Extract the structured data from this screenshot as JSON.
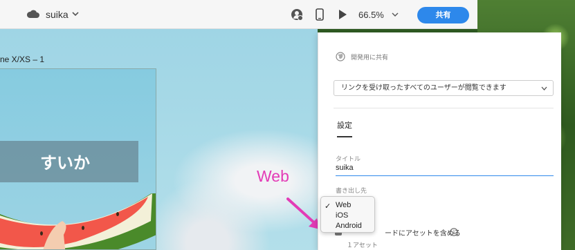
{
  "titlebar": {
    "doc_title": "suika",
    "icons": [
      "cloud-icon",
      "chevron-down-icon",
      "add-user-icon",
      "mobile-preview-icon",
      "play-icon",
      "chevron-down-icon"
    ],
    "zoom": "66.5%",
    "share_button": "共有",
    "accent_color": "#2d88eb"
  },
  "canvas": {
    "artboard_label": "ne X/XS – 1",
    "title_text": "すいか",
    "annotation_text": "Web",
    "annotation_color": "#e33bb6"
  },
  "panel": {
    "share_mode": "開発用に共有",
    "access_option": "リンクを受け取ったすべてのユーザーが閲覧できます",
    "tab": "設定",
    "title_label": "タイトル",
    "title_value": "suika",
    "export_label": "書き出し先",
    "checkbox_label": "ードにアセットを含める",
    "asset_count": "１アセット"
  },
  "dropdown": {
    "selected": "Web",
    "options": [
      "Web",
      "iOS",
      "Android"
    ]
  }
}
